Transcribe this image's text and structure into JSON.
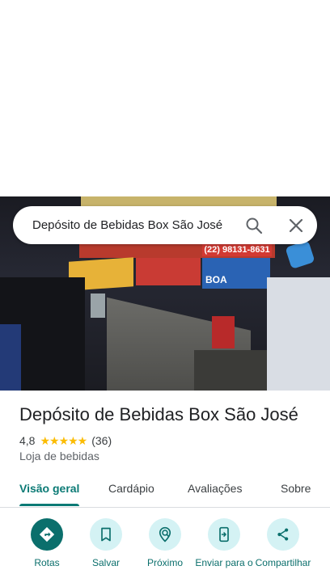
{
  "search": {
    "query": "Depósito de Bebidas Box São José"
  },
  "hero": {
    "phone_text": "(22) 98131-8631",
    "pack_text": "BOA"
  },
  "place": {
    "name": "Depósito de Bebidas Box São José",
    "rating": "4,8",
    "stars": "★★★★★",
    "review_count": "(36)",
    "category": "Loja de bebidas"
  },
  "tabs": [
    {
      "label": "Visão geral",
      "active": true
    },
    {
      "label": "Cardápio",
      "active": false
    },
    {
      "label": "Avaliações",
      "active": false
    },
    {
      "label": "Sobre",
      "active": false
    }
  ],
  "actions": [
    {
      "label": "Rotas",
      "icon": "directions-icon"
    },
    {
      "label": "Salvar",
      "icon": "bookmark-icon"
    },
    {
      "label": "Próximo",
      "icon": "nearby-icon"
    },
    {
      "label": "Enviar para o",
      "icon": "send-to-phone-icon"
    },
    {
      "label": "Compartilhar",
      "icon": "share-icon"
    }
  ],
  "colors": {
    "accent": "#0b7a75",
    "star": "#fbbc04",
    "action_bg": "#d4f2f4"
  }
}
